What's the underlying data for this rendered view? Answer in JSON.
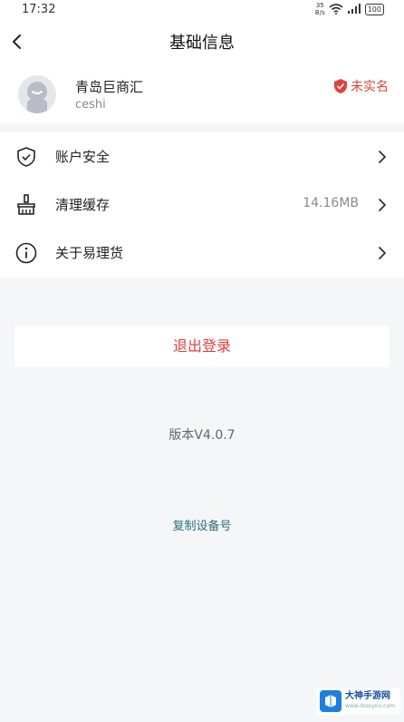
{
  "status_bar": {
    "time": "17:32",
    "net_speed_value": "35",
    "net_speed_unit": "B/s",
    "battery": "100"
  },
  "header": {
    "title": "基础信息",
    "back_icon": "chevron-left-icon"
  },
  "profile": {
    "name": "青岛巨商汇",
    "account": "ceshi",
    "verify_status": "未实名",
    "verify_color": "#e0413e"
  },
  "menu": {
    "items": [
      {
        "label": "账户安全",
        "icon": "shield-check-icon",
        "value": ""
      },
      {
        "label": "清理缓存",
        "icon": "broom-icon",
        "value": "14.16MB"
      },
      {
        "label": "关于易理货",
        "icon": "info-icon",
        "value": ""
      }
    ]
  },
  "actions": {
    "logout_label": "退出登录",
    "version_text": "版本V4.0.7",
    "copy_device_label": "复制设备号"
  },
  "watermark": {
    "title": "大神手游网",
    "subtitle": "www.dsssyou.com"
  }
}
